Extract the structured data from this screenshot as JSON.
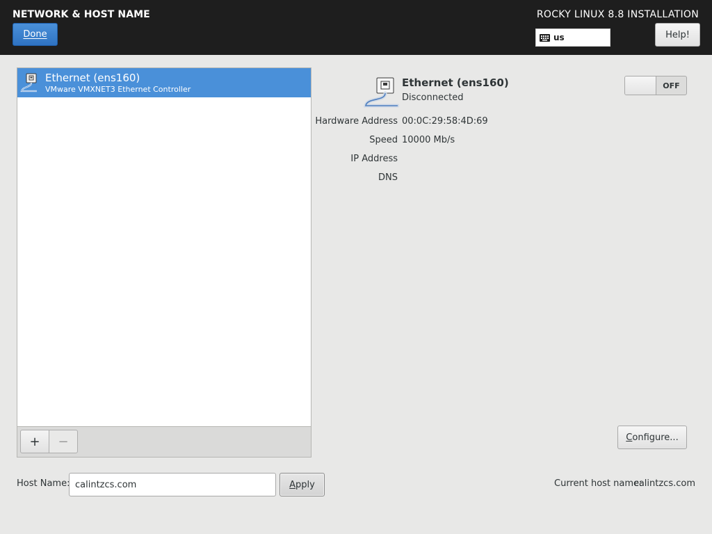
{
  "header": {
    "title": "NETWORK & HOST NAME",
    "done_label": "Done",
    "product": "ROCKY LINUX 8.8 INSTALLATION",
    "keyboard_layout": "us",
    "help_label": "Help!"
  },
  "devices": [
    {
      "name": "Ethernet (ens160)",
      "description": "VMware VMXNET3 Ethernet Controller",
      "selected": true
    }
  ],
  "toolbar": {
    "add_label": "+",
    "remove_label": "−"
  },
  "details": {
    "name": "Ethernet (ens160)",
    "status": "Disconnected",
    "switch_state": "OFF",
    "properties": [
      {
        "label": "Hardware Address",
        "value": "00:0C:29:58:4D:69"
      },
      {
        "label": "Speed",
        "value": "10000 Mb/s"
      },
      {
        "label": "IP Address",
        "value": ""
      },
      {
        "label": "DNS",
        "value": ""
      }
    ],
    "configure_label": "Configure..."
  },
  "hostname": {
    "label": "Host Name:",
    "value": "calintzcs.com",
    "apply_label": "Apply",
    "current_label": "Current host name:",
    "current_value": "calintzcs.com"
  },
  "colors": {
    "header_bg": "#1e1e1e",
    "accent": "#4a90d9",
    "page_bg": "#e8e8e7"
  },
  "icons": {
    "device_row": "ethernet-cable-icon",
    "device_detail": "ethernet-cable-icon",
    "keyboard": "keyboard-icon"
  }
}
